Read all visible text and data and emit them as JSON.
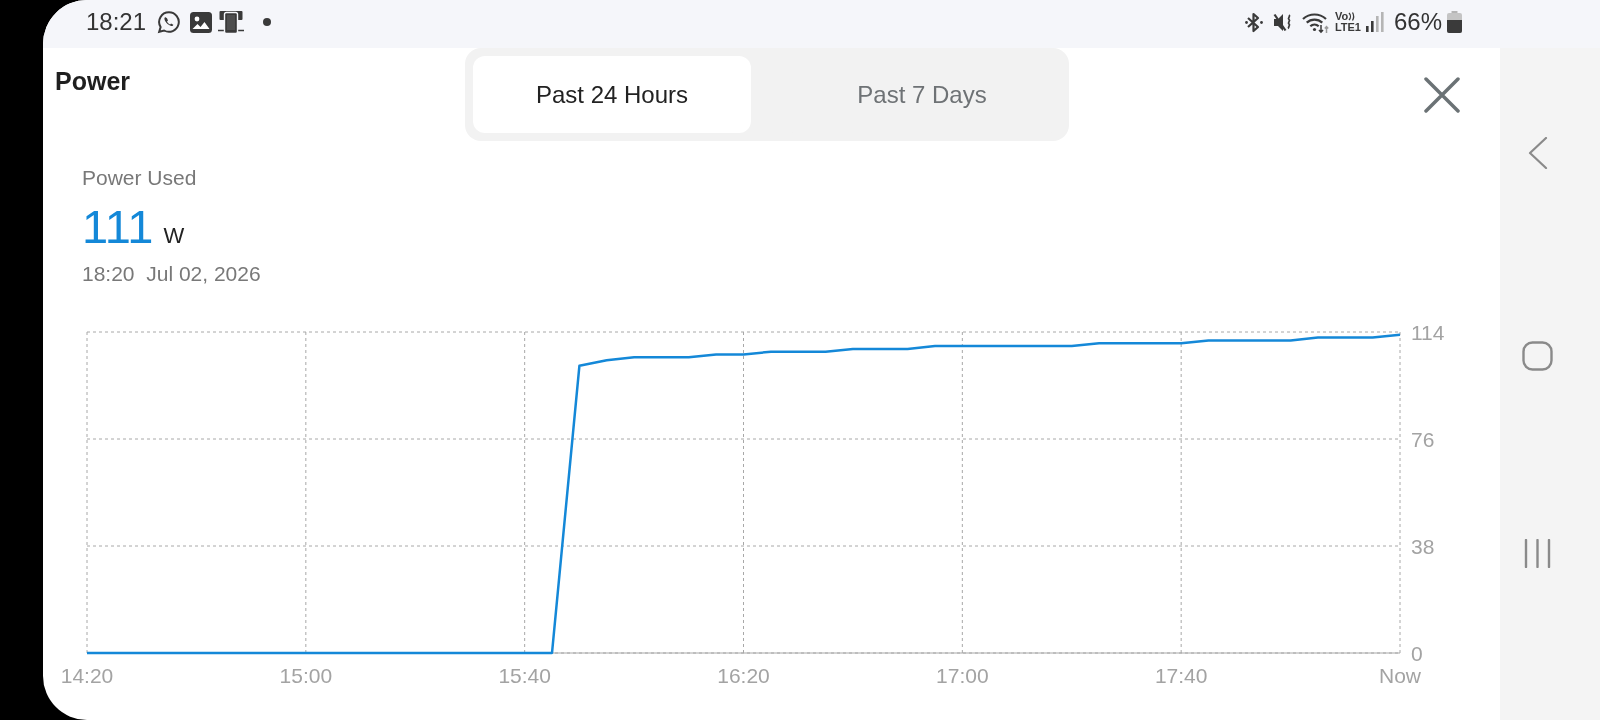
{
  "status_bar": {
    "time": "18:21",
    "volte_label": "Vo",
    "network_label": "LTE1",
    "battery": "66%"
  },
  "header": {
    "title": "Power",
    "tabs": [
      {
        "label": "Past 24 Hours",
        "selected": true
      },
      {
        "label": "Past 7 Days",
        "selected": false
      }
    ]
  },
  "summary": {
    "label": "Power Used",
    "value": "111",
    "unit": "W",
    "timestamp": "18:20  Jul 02, 2026"
  },
  "chart": {
    "chart_data": {
      "type": "line",
      "grid": true,
      "categories": [
        "14:20",
        null,
        null,
        null,
        null,
        null,
        null,
        null,
        "15:00",
        null,
        null,
        null,
        null,
        null,
        null,
        null,
        "15:40",
        null,
        null,
        null,
        null,
        null,
        null,
        null,
        "16:20",
        null,
        null,
        null,
        null,
        null,
        null,
        null,
        "17:00",
        null,
        null,
        null,
        null,
        null,
        null,
        null,
        "17:40",
        null,
        null,
        null,
        null,
        null,
        null,
        null,
        "Now"
      ],
      "series": [
        {
          "color": "#1488d8",
          "values": [
            0,
            0,
            0,
            0,
            0,
            0,
            0,
            0,
            0,
            0,
            0,
            0,
            0,
            0,
            0,
            0,
            0,
            0,
            102,
            104,
            105,
            105,
            105,
            106,
            106,
            107,
            107,
            107,
            108,
            108,
            108,
            109,
            109,
            109,
            109,
            109,
            109,
            110,
            110,
            110,
            110,
            111,
            111,
            111,
            111,
            112,
            112,
            112,
            113
          ]
        }
      ],
      "ylim": [
        0,
        114
      ],
      "yticks": [
        0,
        38,
        76,
        114
      ]
    }
  }
}
